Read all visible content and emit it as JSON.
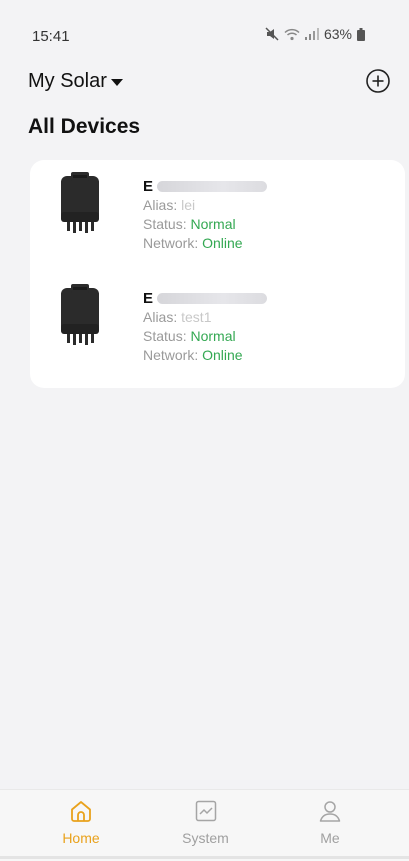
{
  "status_bar": {
    "time": "15:41",
    "battery": "63%"
  },
  "header": {
    "site_name": "My Solar",
    "section_title": "All Devices"
  },
  "labels": {
    "alias": "Alias:",
    "status": "Status:",
    "network": "Network:"
  },
  "devices": [
    {
      "id_prefix": "E",
      "alias": "lei",
      "status": "Normal",
      "network": "Online"
    },
    {
      "id_prefix": "E",
      "alias": "test1",
      "status": "Normal",
      "network": "Online"
    }
  ],
  "tabs": [
    {
      "label": "Home",
      "icon": "home-icon",
      "active": true
    },
    {
      "label": "System",
      "icon": "chart-icon",
      "active": false
    },
    {
      "label": "Me",
      "icon": "person-icon",
      "active": false
    }
  ],
  "colors": {
    "accent": "#e9a21c",
    "online_green": "#33a852",
    "background": "#f3f3f5"
  }
}
